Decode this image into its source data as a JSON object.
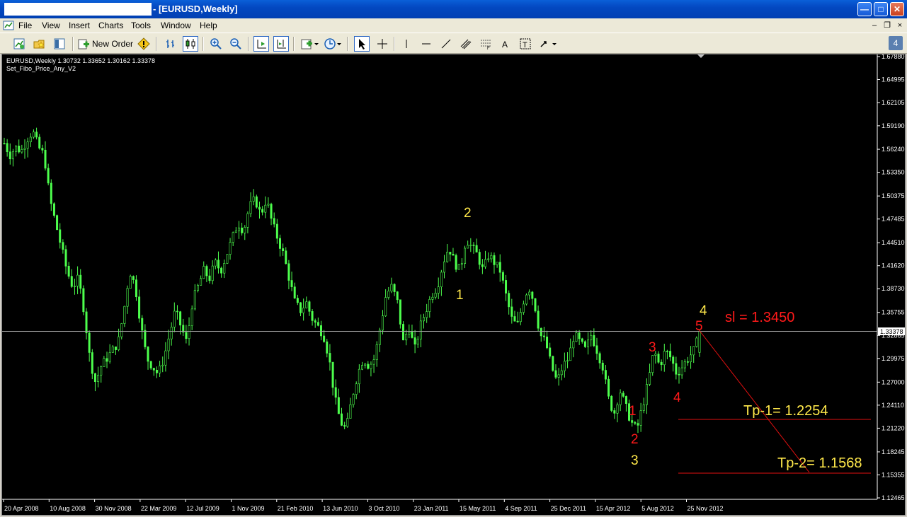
{
  "window": {
    "title": "- [EURUSD,Weekly]",
    "buttons": {
      "minimize": "—",
      "maximize": "□",
      "close": "✕"
    }
  },
  "menu": {
    "items": [
      "File",
      "View",
      "Insert",
      "Charts",
      "Tools",
      "Window",
      "Help"
    ],
    "mdi": {
      "minimize": "–",
      "restore": "❐",
      "close": "×"
    }
  },
  "toolbar": {
    "new_order_label": "New Order",
    "badge": "4",
    "icons": [
      "new-chart-icon",
      "profiles-icon",
      "navigator-icon",
      "new-order-icon",
      "warning-icon",
      "bar-chart-icon",
      "candles-icon",
      "zoom-in-icon",
      "zoom-out-icon",
      "chart-shift-icon",
      "autoscroll-icon",
      "indicators-icon",
      "periods-icon",
      "cursor-icon",
      "crosshair-icon",
      "vertical-line-icon",
      "horizontal-line-icon",
      "trendline-icon",
      "equidistant-channel-icon",
      "fibonacci-icon",
      "text-icon",
      "text-label-icon",
      "arrows-icon"
    ]
  },
  "chart": {
    "info_line1": "EURUSD,Weekly  1.30732 1.33652 1.30162 1.33378",
    "info_line2": "Set_Fibo_Price_Any_V2",
    "current_price_label": "1.33378",
    "colors": {
      "background": "#000000",
      "bull_bar": "#4dff4d",
      "grid_text": "#ffffff",
      "wave_yellow": "#ffe84a",
      "wave_red": "#ff1a1a",
      "price_line": "#a0a0a0"
    },
    "annotations": {
      "sl": "sl = 1.3450",
      "tp1": "Tp-1= 1.2254",
      "tp2": "Tp-2= 1.1568"
    },
    "wave_labels_yellow": [
      "1",
      "2",
      "3",
      "4"
    ],
    "wave_labels_red": [
      "1",
      "2",
      "3",
      "4",
      "5"
    ]
  },
  "chart_data": {
    "type": "candlestick",
    "symbol": "EURUSD",
    "timeframe": "Weekly",
    "ohlc_last": {
      "open": 1.30732,
      "high": 1.33652,
      "low": 1.30162,
      "close": 1.33378
    },
    "y_ticks": [
      "1.67880",
      "1.64995",
      "1.62105",
      "1.59190",
      "1.56240",
      "1.53350",
      "1.50375",
      "1.47485",
      "1.44510",
      "1.41620",
      "1.38730",
      "1.35755",
      "1.32865",
      "1.29975",
      "1.27000",
      "1.24110",
      "1.21220",
      "1.18245",
      "1.15355",
      "1.12465"
    ],
    "ylim": [
      1.12465,
      1.6788
    ],
    "x_ticks": [
      "20 Apr 2008",
      "10 Aug 2008",
      "30 Nov 2008",
      "22 Mar 2009",
      "12 Jul 2009",
      "1 Nov 2009",
      "21 Feb 2010",
      "13 Jun 2010",
      "3 Oct 2010",
      "23 Jan 2011",
      "15 May 2011",
      "4 Sep 2011",
      "25 Dec 2011",
      "15 Apr 2012",
      "5 Aug 2012",
      "25 Nov 2012"
    ],
    "close_path": [
      1.57,
      1.555,
      1.565,
      1.56,
      1.575,
      1.585,
      1.565,
      1.555,
      1.5,
      1.47,
      1.44,
      1.41,
      1.39,
      1.4,
      1.36,
      1.3,
      1.27,
      1.29,
      1.3,
      1.31,
      1.32,
      1.36,
      1.41,
      1.39,
      1.34,
      1.3,
      1.29,
      1.28,
      1.3,
      1.33,
      1.36,
      1.34,
      1.32,
      1.37,
      1.39,
      1.41,
      1.4,
      1.42,
      1.41,
      1.43,
      1.45,
      1.47,
      1.46,
      1.49,
      1.5,
      1.48,
      1.5,
      1.47,
      1.45,
      1.43,
      1.4,
      1.37,
      1.36,
      1.37,
      1.35,
      1.34,
      1.33,
      1.3,
      1.25,
      1.22,
      1.21,
      1.25,
      1.28,
      1.3,
      1.29,
      1.3,
      1.34,
      1.38,
      1.39,
      1.37,
      1.32,
      1.34,
      1.31,
      1.34,
      1.36,
      1.38,
      1.39,
      1.42,
      1.44,
      1.42,
      1.41,
      1.45,
      1.44,
      1.43,
      1.41,
      1.43,
      1.42,
      1.41,
      1.38,
      1.35,
      1.34,
      1.37,
      1.39,
      1.37,
      1.33,
      1.32,
      1.29,
      1.27,
      1.29,
      1.3,
      1.33,
      1.32,
      1.31,
      1.33,
      1.31,
      1.29,
      1.25,
      1.23,
      1.26,
      1.24,
      1.22,
      1.21,
      1.24,
      1.27,
      1.31,
      1.29,
      1.31,
      1.3,
      1.28,
      1.29,
      1.3,
      1.31,
      1.33
    ]
  }
}
